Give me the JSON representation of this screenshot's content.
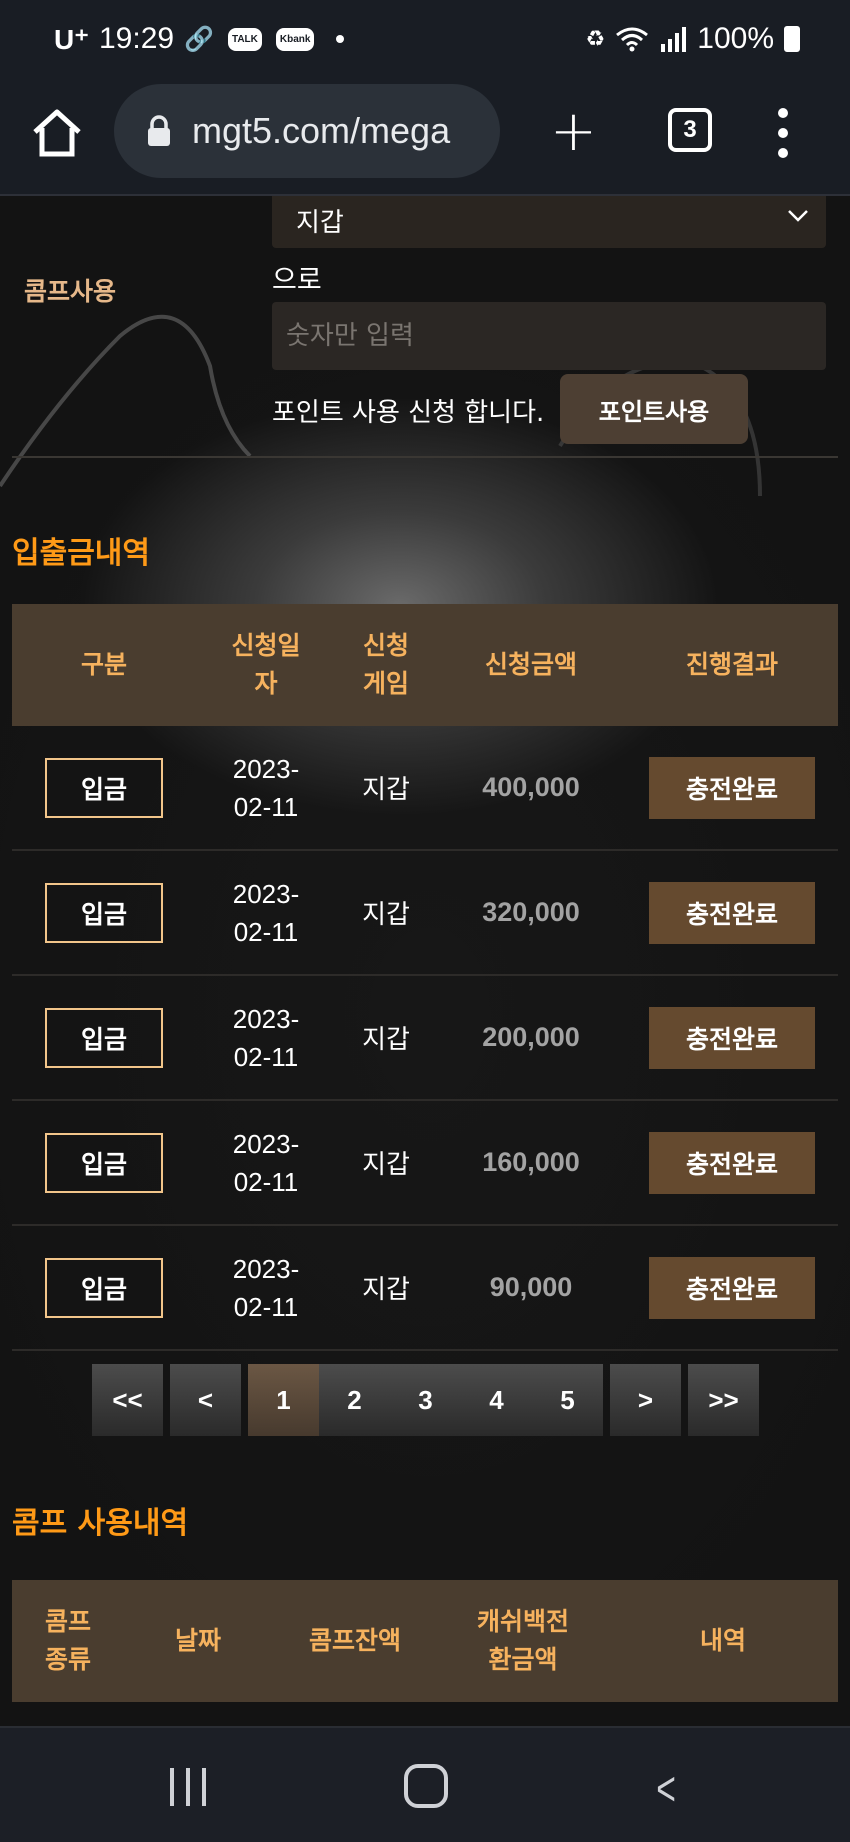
{
  "status_bar": {
    "carrier": "U⁺",
    "time": "19:29",
    "notif_badges": [
      "TALK",
      "Kbank"
    ],
    "battery": "100%"
  },
  "browser": {
    "url": "mgt5.com/mega",
    "tab_count": "3"
  },
  "comp_use": {
    "label": "콤프사용",
    "select_value": "지갑",
    "to_label": "으로",
    "input_placeholder": "숫자만 입력",
    "request_text": "포인트 사용 신청 합니다.",
    "button_label": "포인트사용"
  },
  "deposit_history": {
    "title": "입출금내역",
    "columns": [
      "구분",
      "신청일자",
      "신청게임",
      "신청금액",
      "진행결과"
    ],
    "column_lines": [
      [
        "구분"
      ],
      [
        "신청일",
        "자"
      ],
      [
        "신청",
        "게임"
      ],
      [
        "신청금액"
      ],
      [
        "진행결과"
      ]
    ],
    "rows": [
      {
        "type": "입금",
        "date_line1": "2023-",
        "date_line2": "02-11",
        "game": "지갑",
        "amount": "400,000",
        "status": "충전완료"
      },
      {
        "type": "입금",
        "date_line1": "2023-",
        "date_line2": "02-11",
        "game": "지갑",
        "amount": "320,000",
        "status": "충전완료"
      },
      {
        "type": "입금",
        "date_line1": "2023-",
        "date_line2": "02-11",
        "game": "지갑",
        "amount": "200,000",
        "status": "충전완료"
      },
      {
        "type": "입금",
        "date_line1": "2023-",
        "date_line2": "02-11",
        "game": "지갑",
        "amount": "160,000",
        "status": "충전완료"
      },
      {
        "type": "입금",
        "date_line1": "2023-",
        "date_line2": "02-11",
        "game": "지갑",
        "amount": "90,000",
        "status": "충전완료"
      }
    ]
  },
  "pagination": {
    "first": "<<",
    "prev": "<",
    "pages": [
      "1",
      "2",
      "3",
      "4",
      "5"
    ],
    "active_page": "1",
    "next": ">",
    "last": ">>"
  },
  "comp_history": {
    "title": "콤프 사용내역",
    "column_lines": [
      [
        "콤프",
        "종류"
      ],
      [
        "날짜"
      ],
      [
        "콤프잔액"
      ],
      [
        "캐쉬백전",
        "환금액"
      ],
      [
        "내역"
      ]
    ]
  }
}
